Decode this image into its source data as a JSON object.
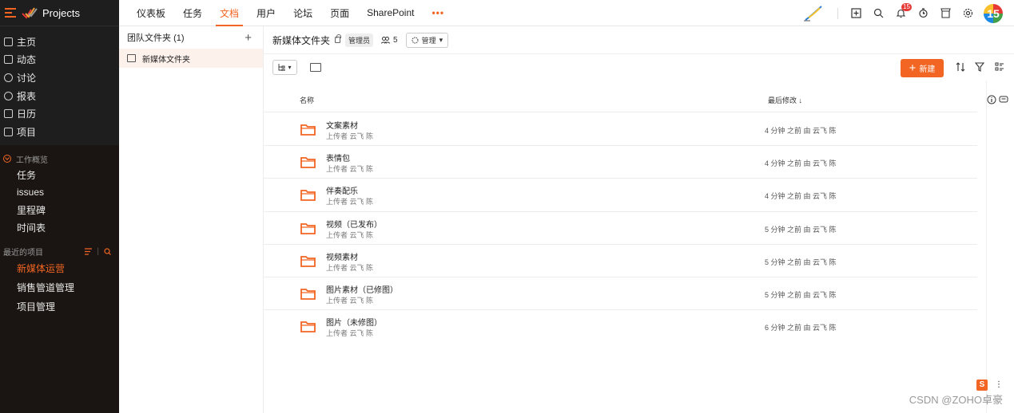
{
  "app": {
    "title": "Projects"
  },
  "sidebar": {
    "nav": [
      {
        "label": "主页",
        "icon": "home-icon"
      },
      {
        "label": "动态",
        "icon": "feed-icon"
      },
      {
        "label": "讨论",
        "icon": "discuss-icon"
      },
      {
        "label": "报表",
        "icon": "report-icon"
      },
      {
        "label": "日历",
        "icon": "calendar-icon"
      },
      {
        "label": "项目",
        "icon": "project-icon"
      }
    ],
    "work_overview": {
      "label": "工作概览",
      "items": [
        "任务",
        "issues",
        "里程碑",
        "时间表"
      ]
    },
    "recent": {
      "label": "最近的项目",
      "items": [
        "新媒体运营",
        "销售管道管理",
        "项目管理"
      ],
      "active": "新媒体运营"
    }
  },
  "topnav": {
    "tabs": [
      "仪表板",
      "任务",
      "文档",
      "用户",
      "论坛",
      "页面",
      "SharePoint",
      "•••"
    ],
    "active": "文档",
    "notification_count": "15",
    "avatar_text": "15"
  },
  "folders": {
    "header": "团队文件夹",
    "count": "(1)",
    "add": "+",
    "items": [
      "新媒体文件夹"
    ]
  },
  "main": {
    "folder_name": "新媒体文件夹",
    "role": "管理员",
    "members": "5",
    "manage_label": "管理",
    "new_label": "新建",
    "columns": {
      "name": "名称",
      "modified": "最后修改"
    },
    "rows": [
      {
        "title": "文案素材",
        "uploader": "上传者 云飞 陈",
        "modified": "4 分钟 之前 由 云飞 陈"
      },
      {
        "title": "表情包",
        "uploader": "上传者 云飞 陈",
        "modified": "4 分钟 之前 由 云飞 陈"
      },
      {
        "title": "伴奏配乐",
        "uploader": "上传者 云飞 陈",
        "modified": "4 分钟 之前 由 云飞 陈"
      },
      {
        "title": "视频（已发布）",
        "uploader": "上传者 云飞 陈",
        "modified": "5 分钟 之前 由 云飞 陈"
      },
      {
        "title": "视频素材",
        "uploader": "上传者 云飞 陈",
        "modified": "5 分钟 之前 由 云飞 陈"
      },
      {
        "title": "图片素材（已修图）",
        "uploader": "上传者 云飞 陈",
        "modified": "5 分钟 之前 由 云飞 陈"
      },
      {
        "title": "图片（未修图）",
        "uploader": "上传者 云飞 陈",
        "modified": "6 分钟 之前 由 云飞 陈"
      }
    ]
  },
  "watermark": "CSDN @ZOHO卓豪",
  "colors": {
    "accent": "#f26522",
    "sidebar_bg": "#1e1e1e",
    "folder": "#f26522"
  }
}
